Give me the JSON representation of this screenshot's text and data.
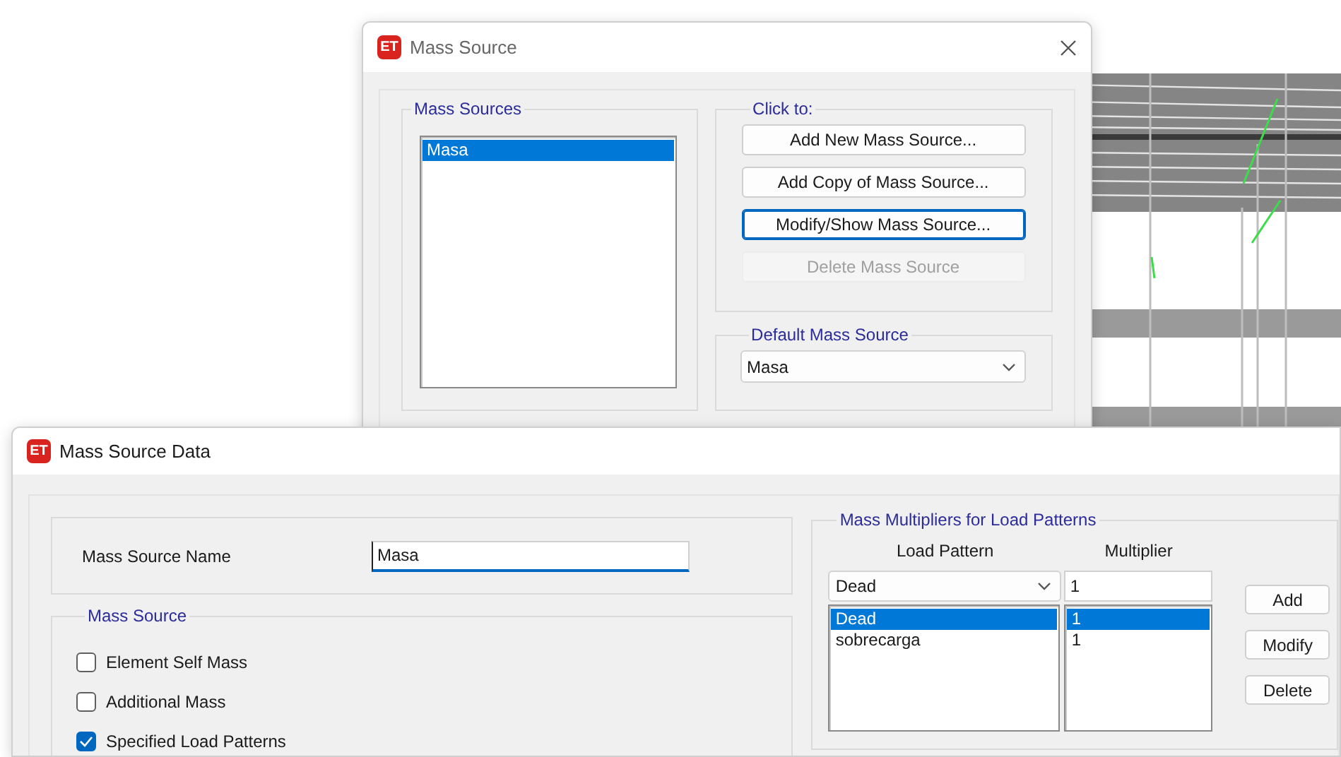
{
  "mass_source_dialog": {
    "logo": "ET",
    "title": "Mass Source",
    "mass_sources": {
      "label": "Mass Sources",
      "items": [
        {
          "text": "Masa",
          "selected": true
        }
      ]
    },
    "click_to": {
      "label": "Click to:",
      "buttons": [
        {
          "label": "Add New Mass Source...",
          "focused": false,
          "disabled": false
        },
        {
          "label": "Add Copy of Mass Source...",
          "focused": false,
          "disabled": false
        },
        {
          "label": "Modify/Show Mass Source...",
          "focused": true,
          "disabled": false
        },
        {
          "label": "Delete Mass Source",
          "focused": false,
          "disabled": true
        }
      ]
    },
    "default_mass_source": {
      "label": "Default Mass Source",
      "value": "Masa"
    }
  },
  "mass_source_data_dialog": {
    "logo": "ET",
    "title": "Mass Source Data",
    "name_label": "Mass Source Name",
    "name_value": "Masa",
    "mass_source": {
      "label": "Mass Source",
      "options": [
        {
          "label": "Element Self Mass",
          "checked": false
        },
        {
          "label": "Additional Mass",
          "checked": false
        },
        {
          "label": "Specified Load Patterns",
          "checked": true
        }
      ]
    },
    "multipliers": {
      "label": "Mass Multipliers for Load Patterns",
      "columns": [
        "Load Pattern",
        "Multiplier"
      ],
      "load_pattern_value": "Dead",
      "multiplier_value": "1",
      "rows": [
        {
          "load_pattern": "Dead",
          "multiplier": "1",
          "selected": true
        },
        {
          "load_pattern": "sobrecarga",
          "multiplier": "1",
          "selected": false
        }
      ],
      "buttons": [
        "Add",
        "Modify",
        "Delete"
      ]
    }
  }
}
